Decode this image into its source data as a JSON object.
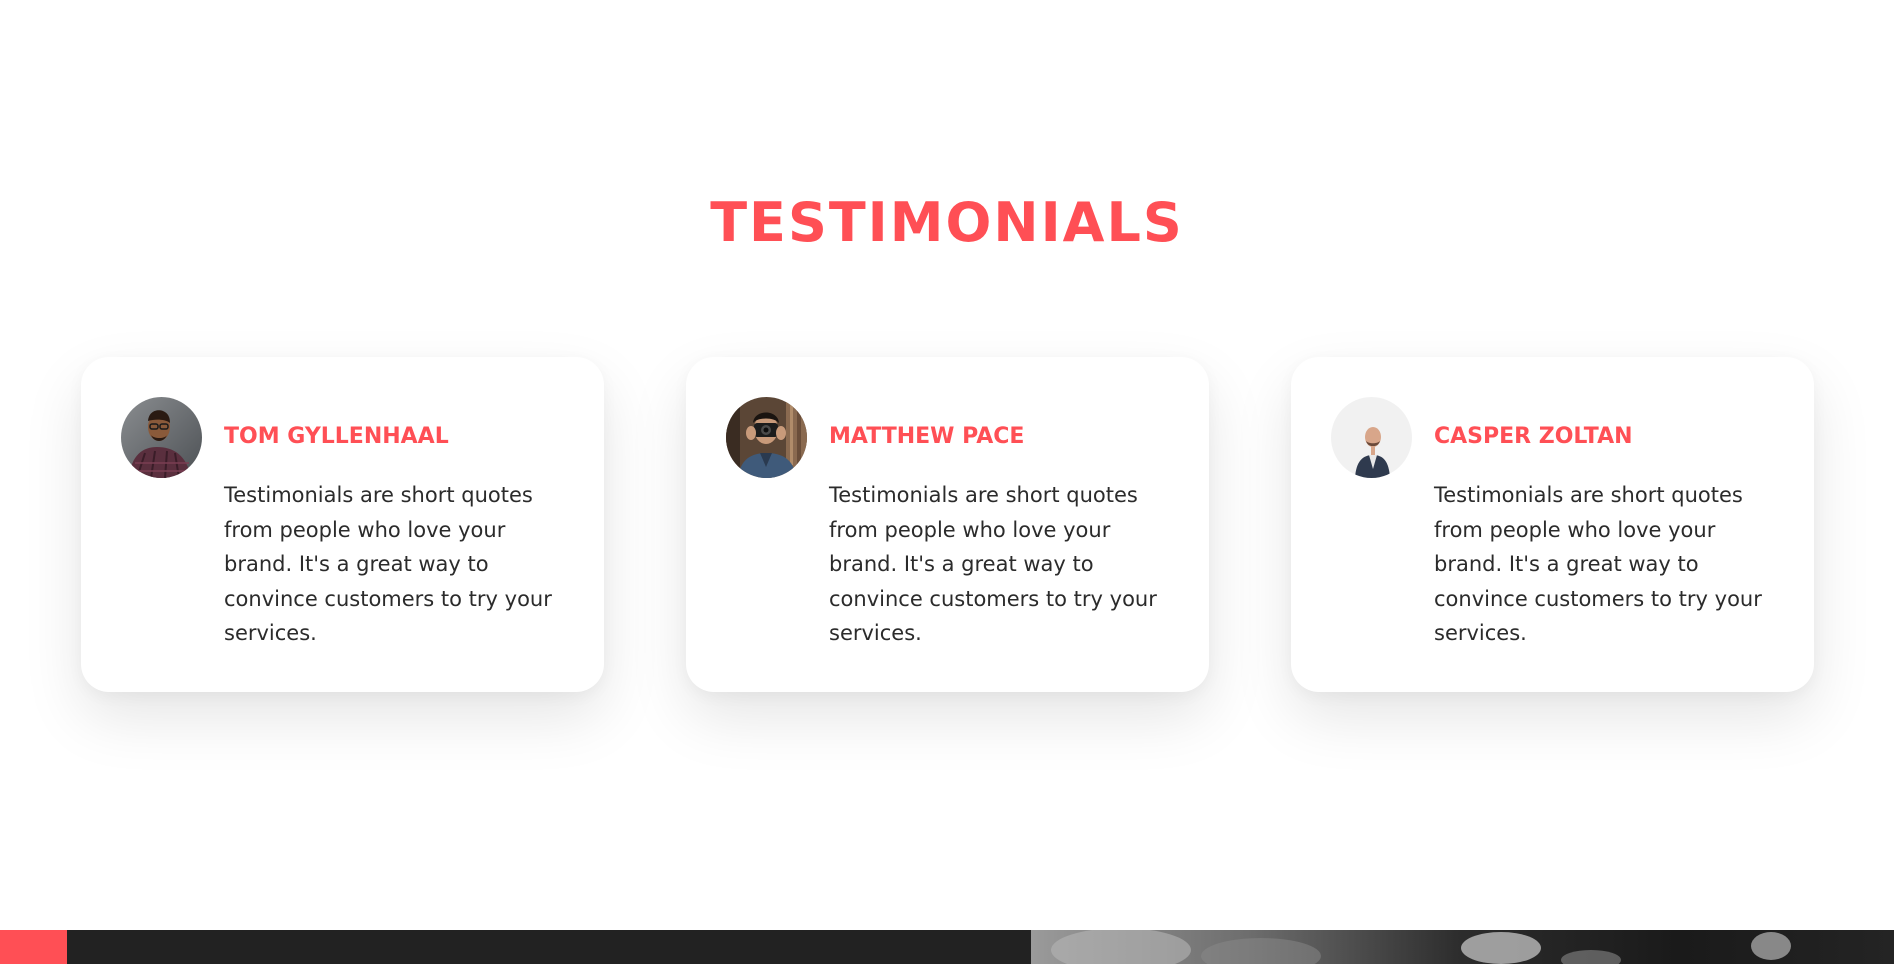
{
  "section": {
    "title": "TESTIMONIALS"
  },
  "testimonials": [
    {
      "name": "TOM GYLLENHAAL",
      "quote": "Testimonials are short quotes from people who love your brand. It's a great way to convince customers to try your services.",
      "avatar_icon": "avatar-photo-tom"
    },
    {
      "name": "MATTHEW PACE",
      "quote": "Testimonials are short quotes from people who love your brand. It's a great way to convince customers to try your services.",
      "avatar_icon": "avatar-photo-matthew"
    },
    {
      "name": "CASPER ZOLTAN",
      "quote": "Testimonials are short quotes from people who love your brand. It's a great way to convince customers to try your services.",
      "avatar_icon": "avatar-photo-casper"
    }
  ],
  "colors": {
    "accent": "#ff4f55",
    "text": "#2b2b2b",
    "card_background": "#ffffff",
    "footer_background": "#222222"
  }
}
